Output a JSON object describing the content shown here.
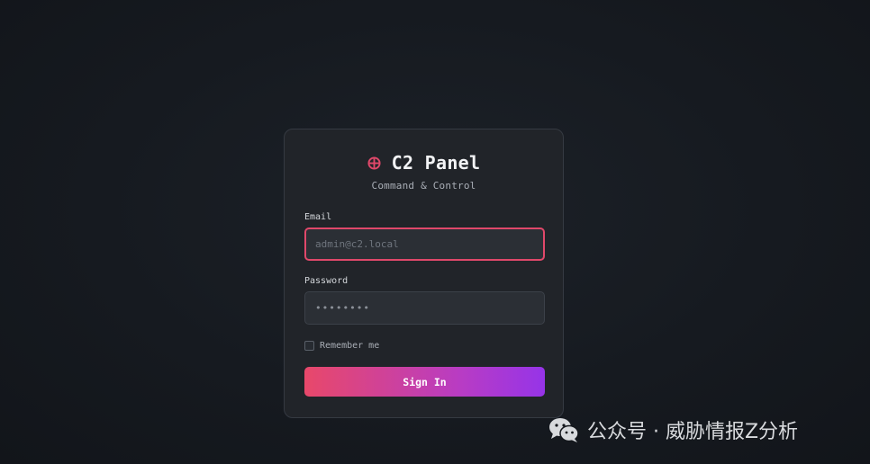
{
  "login": {
    "title": "C2 Panel",
    "subtitle": "Command & Control",
    "logo_icon": "crosshair-icon",
    "accent_color": "#e0486a",
    "email": {
      "label": "Email",
      "value": "",
      "placeholder": "admin@c2.local"
    },
    "password": {
      "label": "Password",
      "value": "",
      "placeholder": "••••••••"
    },
    "remember": {
      "label": "Remember me",
      "checked": false
    },
    "submit_label": "Sign In",
    "button_gradient": [
      "#e8486a",
      "#9634e8"
    ]
  },
  "watermark": {
    "icon": "wechat-icon",
    "text": "公众号 · 威胁情报Z分析"
  }
}
